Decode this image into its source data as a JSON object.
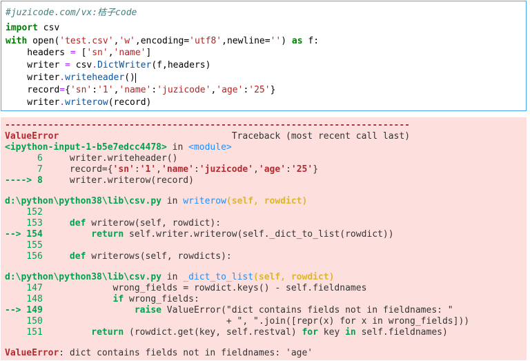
{
  "code_cell": {
    "comment": "#juzicode.com/vx:桔子code",
    "l1_kw": "import",
    "l1_rest": " csv",
    "l2_kw": "with",
    "l2_a": " open(",
    "l2_s1": "'test.csv'",
    "l2_c1": ",",
    "l2_s2": "'w'",
    "l2_c2": ",encoding=",
    "l2_s3": "'utf8'",
    "l2_c3": ",newline=",
    "l2_s4": "''",
    "l2_c4": ") ",
    "l2_kw2": "as",
    "l2_end": " f:",
    "l3_a": "    headers ",
    "l3_op": "=",
    "l3_b": " [",
    "l3_s1": "'sn'",
    "l3_c": ",",
    "l3_s2": "'name'",
    "l3_e": "]",
    "l4_a": "    writer ",
    "l4_op": "=",
    "l4_b": " csv",
    "l4_dot": ".",
    "l4_fn": "DictWriter",
    "l4_e": "(f,headers)",
    "l5_a": "    writer",
    "l5_dot": ".",
    "l5_fn": "writeheader",
    "l5_e": "()",
    "l6_a": "    record",
    "l6_op": "=",
    "l6_b": "{",
    "l6_s1": "'sn'",
    "l6_c1": ":",
    "l6_s2": "'1'",
    "l6_c2": ",",
    "l6_s3": "'name'",
    "l6_c3": ":",
    "l6_s4": "'juzicode'",
    "l6_c4": ",",
    "l6_s5": "'age'",
    "l6_c5": ":",
    "l6_s6": "'25'",
    "l6_e": "}",
    "l7_a": "    writer",
    "l7_dot": ".",
    "l7_fn": "writerow",
    "l7_e": "(record)"
  },
  "traceback": {
    "dashes": "---------------------------------------------------------------------------",
    "err_name": "ValueError",
    "tb_title": "                                Traceback (most recent call last)",
    "f1_loc": "<ipython-input-1-b5e7edcc4478>",
    "f1_in": " in ",
    "f1_mod": "<module>",
    "f1_l6_n": "      6",
    "f1_l6_c": "     writer.writeheader()",
    "f1_l7_n": "      7",
    "f1_l7_a": "     record={",
    "f1_l7_s1": "'sn'",
    "f1_l7_c1": ":",
    "f1_l7_s2": "'1'",
    "f1_l7_c2": ",",
    "f1_l7_s3": "'name'",
    "f1_l7_c3": ":",
    "f1_l7_s4": "'juzicode'",
    "f1_l7_c4": ",",
    "f1_l7_s5": "'age'",
    "f1_l7_c5": ":",
    "f1_l7_s6": "'25'",
    "f1_l7_e": "}",
    "f1_l8_arrow": "----> 8",
    "f1_l8_c": "     writer.writerow(record)",
    "f2_path": "d:\\python\\python38\\lib\\csv.py",
    "f2_in": " in ",
    "f2_fn": "writerow",
    "f2_args": "(self, rowdict)",
    "f2_l152": "    152",
    "f2_l153_n": "    153",
    "f2_l153_kw": "     def",
    "f2_l153_c": " writerow(self, rowdict):",
    "f2_l154_arrow": "--> 154",
    "f2_l154_kw": "         return",
    "f2_l154_c": " self.writer.writerow(self._dict_to_list(rowdict))",
    "f2_l155": "    155",
    "f2_l156_n": "    156",
    "f2_l156_kw": "     def",
    "f2_l156_c": " writerows(self, rowdicts):",
    "f3_path": "d:\\python\\python38\\lib\\csv.py",
    "f3_in": " in ",
    "f3_fn": "_dict_to_list",
    "f3_args": "(self, rowdict)",
    "f3_l147_n": "    147",
    "f3_l147_c": "             wrong_fields = rowdict.keys() - self.fieldnames",
    "f3_l148_n": "    148",
    "f3_l148_kw": "             if",
    "f3_l148_c": " wrong_fields:",
    "f3_l149_arrow": "--> 149",
    "f3_l149_kw": "                 raise",
    "f3_l149_c": " ValueError(\"dict contains fields not in fieldnames: \"",
    "f3_l150_n": "    150",
    "f3_l150_c": "                                  + \", \".join([repr(x) for x in wrong_fields]))",
    "f3_l151_n": "    151",
    "f3_l151_kw": "         return",
    "f3_l151_a": " (rowdict.get(key, self.restval) ",
    "f3_l151_kw2": "for",
    "f3_l151_b": " key ",
    "f3_l151_kw3": "in",
    "f3_l151_e": " self.fieldnames)",
    "final_name": "ValueError",
    "final_msg": ": dict contains fields not in fieldnames: 'age'"
  }
}
